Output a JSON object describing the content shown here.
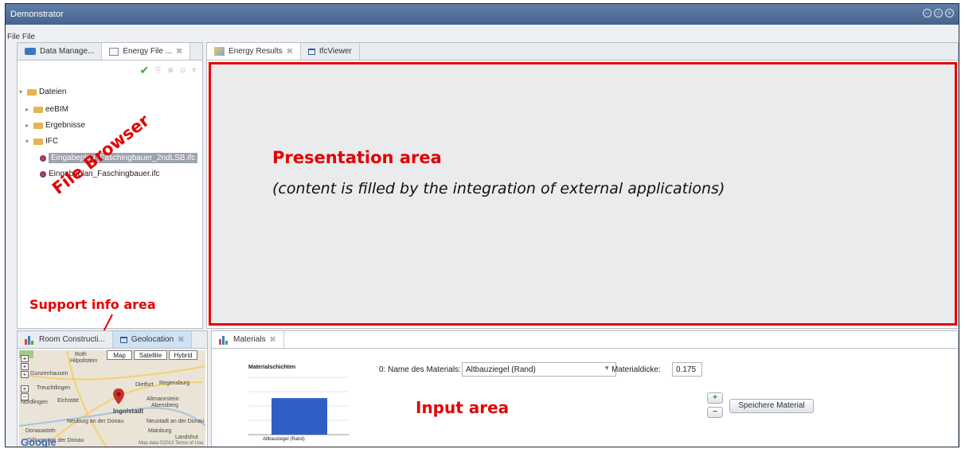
{
  "window": {
    "title": "Demonstrator"
  },
  "menubar": {
    "text": "File File"
  },
  "left_tabs": [
    {
      "label": "Data Manage..."
    },
    {
      "label": "Energy File ...",
      "close": "⌘"
    }
  ],
  "toolbar": {
    "check": "✔",
    "icons": [
      "⎘",
      "⊗",
      "⊙",
      "▿"
    ]
  },
  "tree": {
    "root": "Dateien",
    "items": [
      "eeBIM",
      "Ergebnisse",
      "IFC"
    ],
    "files": [
      "Eingabeplan_Faschingbauer_2ndLSB.ifc",
      "Eingabeplan_Faschingbauer.ifc"
    ]
  },
  "top_tabs": [
    {
      "label": "Energy Results",
      "close": "⌘"
    },
    {
      "label": "IfcViewer"
    }
  ],
  "annotations": {
    "file_browser": "File Browser",
    "support_info": "Support info area",
    "presentation_title": "Presentation area",
    "presentation_sub": "(content is filled by the integration of external applications)",
    "input_area": "Input area"
  },
  "bottom_left_tabs": [
    {
      "label": "Room Constructi..."
    },
    {
      "label": "Geolocation",
      "close": "⌘"
    }
  ],
  "map": {
    "types": [
      "Map",
      "Satellite",
      "Hybrid"
    ],
    "labels": [
      "Roth",
      "Hilpoltstein",
      "Gunzenhausen",
      "Treuchtlingen",
      "Nördlingen",
      "Eichstätt",
      "Ingolstadt",
      "Neuburg an der Donau",
      "Donauwörth",
      "Neustadt an der Donau",
      "Mainburg",
      "Dillingen an der Donau",
      "Abensberg",
      "Altmannstein",
      "Regensburg",
      "Landshut",
      "Dietfurt"
    ],
    "copyright": "Map data ©2013 Terms of Use",
    "logo": "Google",
    "zoom": [
      "+",
      "+",
      "+",
      "+",
      "−"
    ]
  },
  "materials_tab": {
    "label": "Materials",
    "close": "⌘"
  },
  "materials": {
    "chart_title": "Materialschichten",
    "material_name_label": "0: Name des Materials:",
    "material_name_value": "Altbauziegel (Rand)",
    "thickness_label": "Materialdicke:",
    "thickness_value": "0.175",
    "save_button": "Speichere Material",
    "add": "+",
    "remove": "−"
  },
  "chart_data": {
    "type": "bar",
    "title": "Materialschichten",
    "categories": [
      "Altbauziegel (Rand)"
    ],
    "values": [
      0.175
    ],
    "colors": [
      "#2f5fc4"
    ]
  }
}
